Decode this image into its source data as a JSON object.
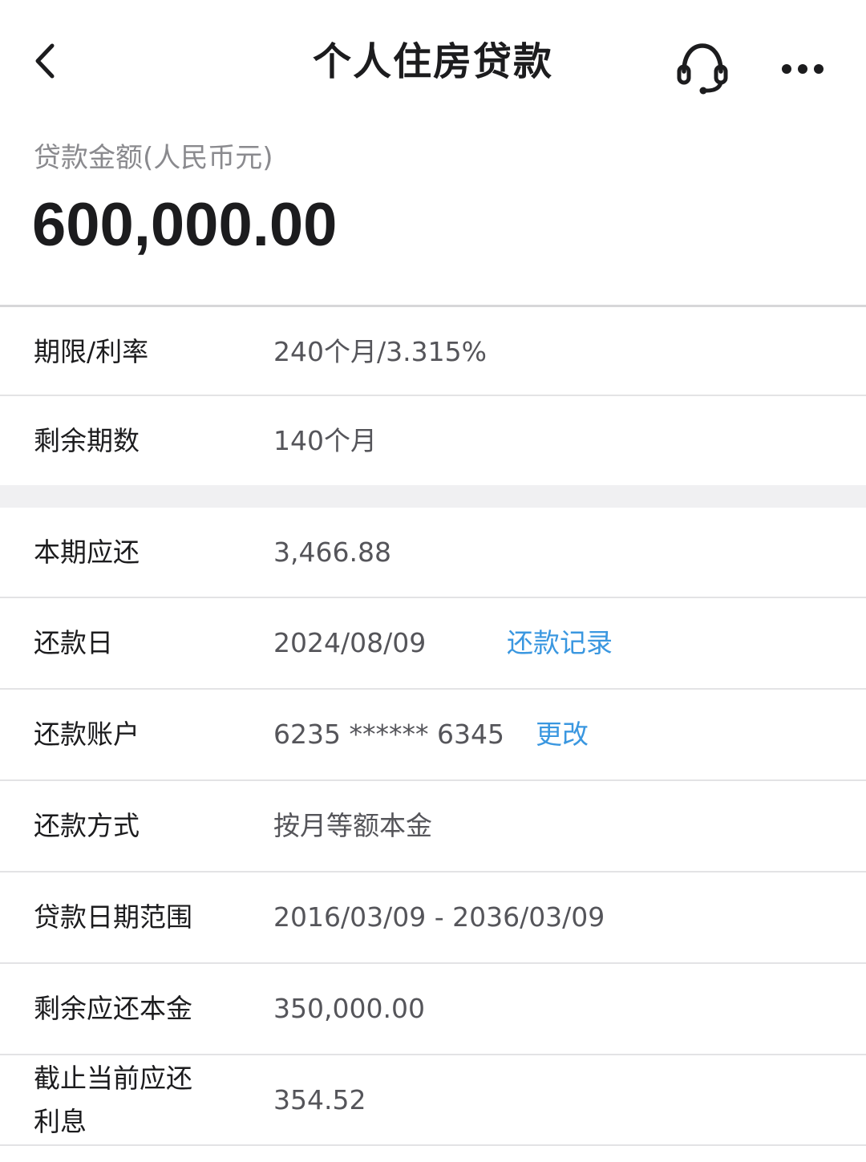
{
  "header": {
    "title": "个人住房贷款",
    "back_icon": "chevron-left-icon",
    "support_icon": "headset-icon",
    "more_icon": "more-dots-icon"
  },
  "amount": {
    "label": "贷款金额(人民币元)",
    "value": "600,000.00"
  },
  "rows": [
    {
      "label": "期限/利率",
      "value": "240个月/3.315%"
    },
    {
      "label": "剩余期数",
      "value": "140个月"
    },
    {
      "label": "本期应还",
      "value": "3,466.88"
    },
    {
      "label": "还款日",
      "value": "2024/08/09",
      "link": "还款记录"
    },
    {
      "label": "还款账户",
      "value": "6235 ****** 6345",
      "link": "更改"
    },
    {
      "label": "还款方式",
      "value": "按月等额本金"
    },
    {
      "label": "贷款日期范围",
      "value": "2016/03/09 - 2036/03/09"
    },
    {
      "label": "剩余应还本金",
      "value": "350,000.00"
    },
    {
      "label_line1": "截止当前应还",
      "label_line2": "利息",
      "value": "354.52"
    }
  ],
  "colors": {
    "link": "#3a97e0",
    "label": "#1c1c1e",
    "value": "#55555a",
    "muted": "#8a8a8e"
  }
}
